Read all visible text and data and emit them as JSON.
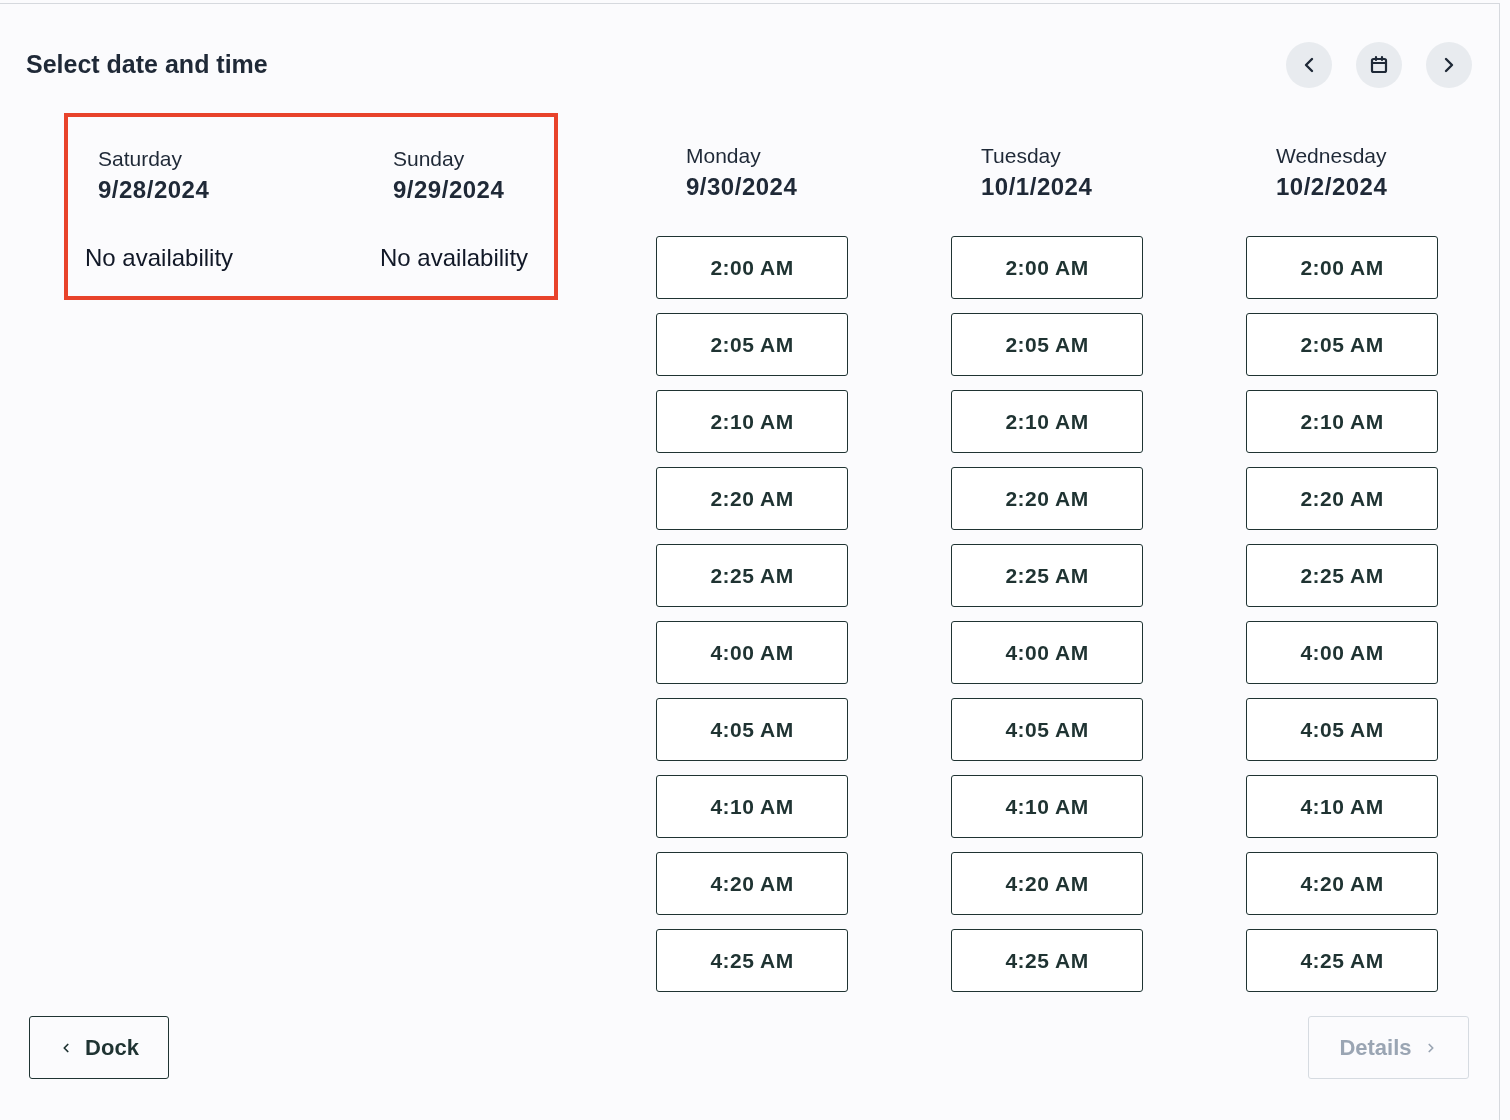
{
  "title": "Select date and time",
  "nav": [
    {
      "kind": "prev"
    },
    {
      "kind": "calendar"
    },
    {
      "kind": "next"
    }
  ],
  "day_groups": [
    {
      "highlighted": true,
      "days": [
        {
          "kind": "unavailable",
          "weekday": "Saturday",
          "date": "9/28/2024",
          "note": "No availability"
        },
        {
          "kind": "unavailable",
          "weekday": "Sunday",
          "date": "9/29/2024",
          "note": "No availability"
        }
      ]
    },
    {
      "highlighted": false,
      "days": [
        {
          "kind": "slots",
          "weekday": "Monday",
          "date": "9/30/2024",
          "slots": [
            "2:00 AM",
            "2:05 AM",
            "2:10 AM",
            "2:20 AM",
            "2:25 AM",
            "4:00 AM",
            "4:05 AM",
            "4:10 AM",
            "4:20 AM",
            "4:25 AM"
          ]
        },
        {
          "kind": "slots",
          "weekday": "Tuesday",
          "date": "10/1/2024",
          "slots": [
            "2:00 AM",
            "2:05 AM",
            "2:10 AM",
            "2:20 AM",
            "2:25 AM",
            "4:00 AM",
            "4:05 AM",
            "4:10 AM",
            "4:20 AM",
            "4:25 AM"
          ]
        },
        {
          "kind": "slots",
          "weekday": "Wednesday",
          "date": "10/2/2024",
          "slots": [
            "2:00 AM",
            "2:05 AM",
            "2:10 AM",
            "2:20 AM",
            "2:25 AM",
            "4:00 AM",
            "4:05 AM",
            "4:10 AM",
            "4:20 AM",
            "4:25 AM"
          ]
        }
      ]
    }
  ],
  "back_button": {
    "label": "Dock",
    "disabled": false
  },
  "next_button": {
    "label": "Details",
    "disabled": true
  }
}
